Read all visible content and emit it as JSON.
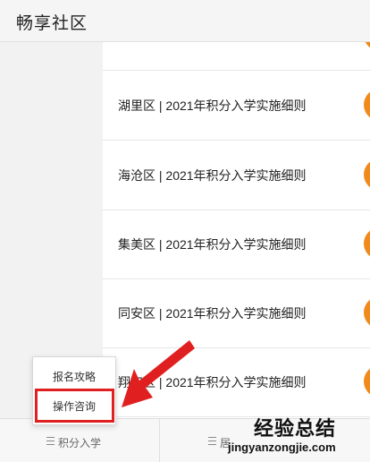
{
  "header": {
    "title": "畅享社区"
  },
  "list": {
    "items": [
      {
        "label": ""
      },
      {
        "label": "湖里区 | 2021年积分入学实施细则"
      },
      {
        "label": "海沧区 | 2021年积分入学实施细则"
      },
      {
        "label": "集美区 | 2021年积分入学实施细则"
      },
      {
        "label": "同安区 | 2021年积分入学实施细则"
      },
      {
        "label": "翔安区 | 2021年积分入学实施细则"
      }
    ]
  },
  "bottom_bar": {
    "tabs": [
      {
        "label": "积分入学",
        "icon": "menu-icon"
      },
      {
        "label": "居",
        "icon": "menu-icon"
      }
    ]
  },
  "popup_menu": {
    "items": [
      {
        "label": "报名攻略"
      },
      {
        "label": "操作咨询"
      }
    ]
  },
  "annotation": {
    "color": "#e02020"
  },
  "watermark": {
    "text": "经验总结",
    "url": "jingyanzongjie.com"
  },
  "colors": {
    "avatar": "#f08a1d",
    "highlight": "#e02020"
  }
}
